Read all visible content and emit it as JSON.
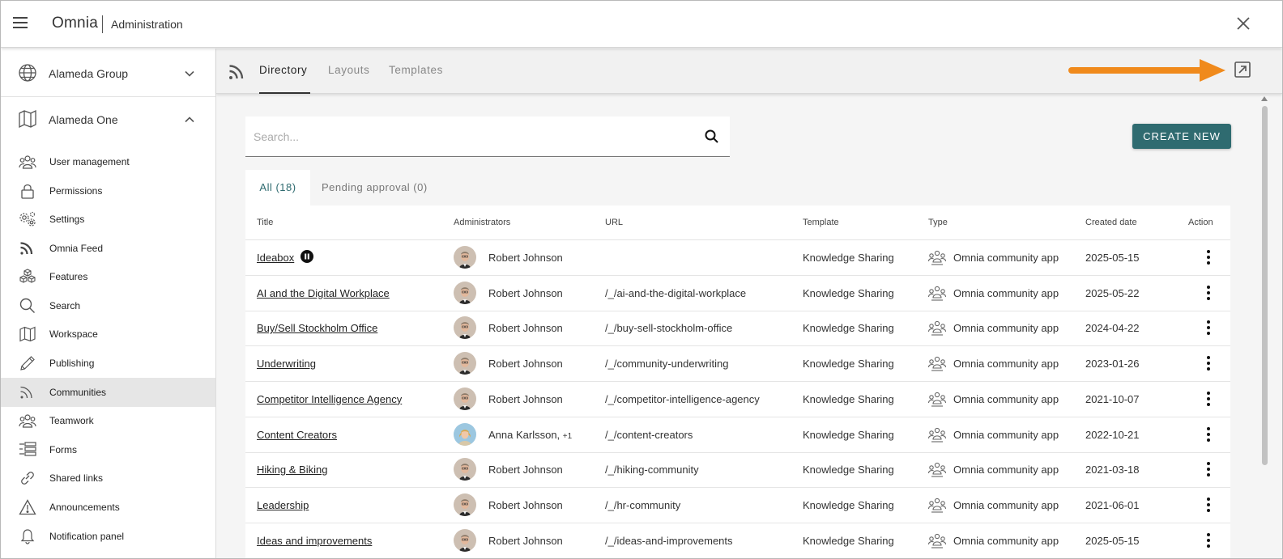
{
  "app": {
    "brand": "Omnia",
    "section": "Administration"
  },
  "sidebar": {
    "tenants": [
      {
        "label": "Alameda Group",
        "icon": "globe-icon",
        "expanded": false
      },
      {
        "label": "Alameda One",
        "icon": "map-icon",
        "expanded": true
      }
    ],
    "items": [
      {
        "label": "User management",
        "icon": "users-icon"
      },
      {
        "label": "Permissions",
        "icon": "lock-icon"
      },
      {
        "label": "Settings",
        "icon": "gears-icon"
      },
      {
        "label": "Omnia Feed",
        "icon": "rss-icon"
      },
      {
        "label": "Features",
        "icon": "cubes-icon"
      },
      {
        "label": "Search",
        "icon": "search-icon"
      },
      {
        "label": "Workspace",
        "icon": "map-icon"
      },
      {
        "label": "Publishing",
        "icon": "pencil-icon"
      },
      {
        "label": "Communities",
        "icon": "rss-icon",
        "active": true
      },
      {
        "label": "Teamwork",
        "icon": "users-icon"
      },
      {
        "label": "Forms",
        "icon": "forms-icon"
      },
      {
        "label": "Shared links",
        "icon": "link-icon"
      },
      {
        "label": "Announcements",
        "icon": "warning-icon"
      },
      {
        "label": "Notification panel",
        "icon": "bell-icon"
      }
    ]
  },
  "tabs": [
    {
      "label": "Directory",
      "active": true
    },
    {
      "label": "Layouts"
    },
    {
      "label": "Templates"
    }
  ],
  "search": {
    "placeholder": "Search..."
  },
  "create_new_label": "CREATE NEW",
  "list_tabs": {
    "all": "All (18)",
    "pending": "Pending approval (0)"
  },
  "table": {
    "headers": {
      "title": "Title",
      "administrators": "Administrators",
      "url": "URL",
      "template": "Template",
      "type": "Type",
      "created": "Created date",
      "action": "Action"
    },
    "rows": [
      {
        "title": "Ideabox",
        "admin": "Robert Johnson",
        "url": "",
        "template": "Knowledge Sharing",
        "type": "Omnia community app",
        "created": "2025-05-15",
        "paused": true
      },
      {
        "title": "AI and the Digital Workplace",
        "admin": "Robert Johnson",
        "url": "/_/ai-and-the-digital-workplace",
        "template": "Knowledge Sharing",
        "type": "Omnia community app",
        "created": "2025-05-22"
      },
      {
        "title": "Buy/Sell Stockholm Office",
        "admin": "Robert Johnson",
        "url": "/_/buy-sell-stockholm-office",
        "template": "Knowledge Sharing",
        "type": "Omnia community app",
        "created": "2024-04-22"
      },
      {
        "title": "Underwriting",
        "admin": "Robert Johnson",
        "url": "/_/community-underwriting",
        "template": "Knowledge Sharing",
        "type": "Omnia community app",
        "created": "2023-01-26"
      },
      {
        "title": "Competitor Intelligence Agency",
        "admin": "Robert Johnson",
        "url": "/_/competitor-intelligence-agency",
        "template": "Knowledge Sharing",
        "type": "Omnia community app",
        "created": "2021-10-07"
      },
      {
        "title": "Content Creators",
        "admin": "Anna Karlsson,",
        "admin_extra": "+1",
        "url": "/_/content-creators",
        "template": "Knowledge Sharing",
        "type": "Omnia community app",
        "created": "2022-10-21",
        "avatar": "female"
      },
      {
        "title": "Hiking & Biking",
        "admin": "Robert Johnson",
        "url": "/_/hiking-community",
        "template": "Knowledge Sharing",
        "type": "Omnia community app",
        "created": "2021-03-18"
      },
      {
        "title": "Leadership",
        "admin": "Robert Johnson",
        "url": "/_/hr-community",
        "template": "Knowledge Sharing",
        "type": "Omnia community app",
        "created": "2021-06-01"
      },
      {
        "title": "Ideas and improvements",
        "admin": "Robert Johnson",
        "url": "/_/ideas-and-improvements",
        "template": "Knowledge Sharing",
        "type": "Omnia community app",
        "created": "2025-05-15"
      }
    ]
  },
  "colors": {
    "accent": "#2f6b70",
    "arrow": "#f08a1c",
    "active_nav": "#e6e6e6"
  }
}
